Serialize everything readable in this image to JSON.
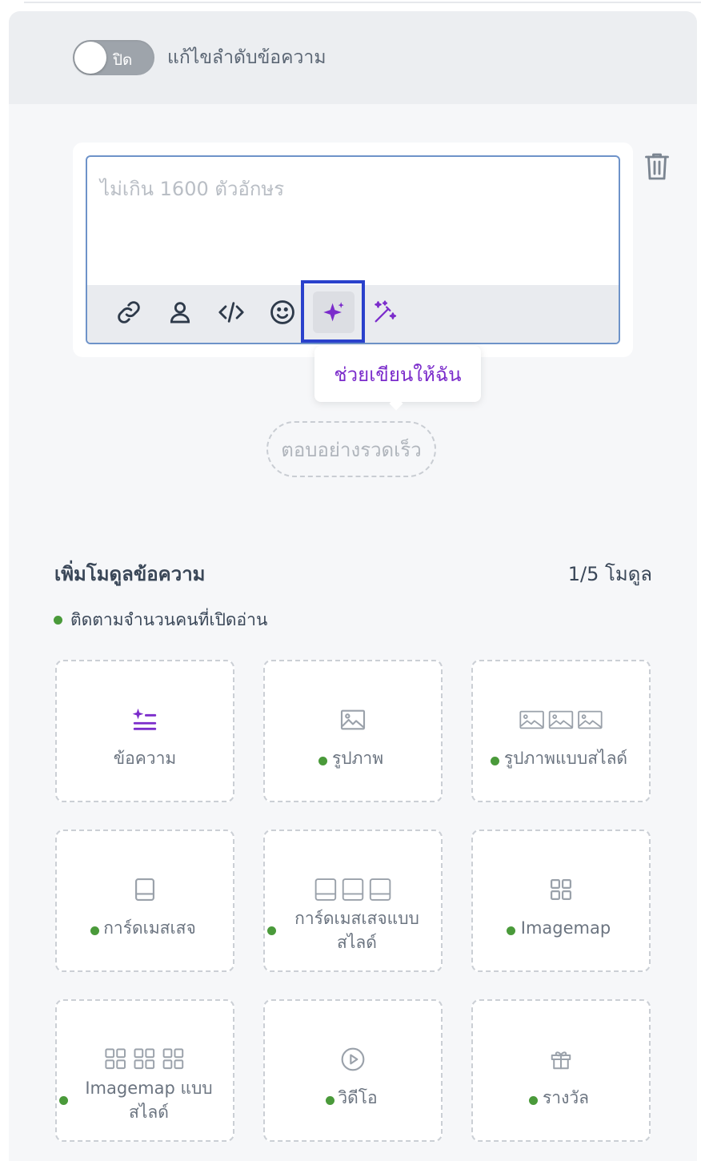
{
  "header": {
    "toggle_state": "ปิด",
    "toggle_label": "แก้ไขลำดับข้อความ"
  },
  "editor": {
    "placeholder": "ไม่เกิน 1600 ตัวอักษร",
    "tooltip": "ช่วยเขียนให้ฉัน",
    "toolbar_icons": [
      "link-icon",
      "person-icon",
      "code-icon",
      "smile-icon",
      "sparkle-icon",
      "magic-wand-icon"
    ]
  },
  "quick_reply": {
    "label": "ตอบอย่างรวดเร็ว"
  },
  "modules": {
    "title": "เพิ่มโมดูลข้อความ",
    "count": "1/5 โมดูล",
    "legend": "ติดตามจำนวนคนที่เปิดอ่าน",
    "items": [
      {
        "label": "ข้อความ",
        "icon": "text-ai-icon",
        "tracked": false
      },
      {
        "label": "รูปภาพ",
        "icon": "image-icon",
        "tracked": true
      },
      {
        "label": "รูปภาพแบบสไลด์",
        "icon": "image-carousel-icon",
        "tracked": true
      },
      {
        "label": "การ์ดเมสเสจ",
        "icon": "card-icon",
        "tracked": true
      },
      {
        "label_line1": "การ์ดเมสเสจแบบ",
        "label_line2": "สไลด์",
        "icon": "card-carousel-icon",
        "tracked": true
      },
      {
        "label": "Imagemap",
        "icon": "imagemap-icon",
        "tracked": true
      },
      {
        "label_line1": "Imagemap แบบ",
        "label_line2": "สไลด์",
        "icon": "imagemap-carousel-icon",
        "tracked": true
      },
      {
        "label": "วิดีโอ",
        "icon": "video-icon",
        "tracked": true
      },
      {
        "label": "รางวัล",
        "icon": "gift-icon",
        "tracked": true
      }
    ]
  },
  "colors": {
    "accent_purple": "#7b2ccb",
    "highlight_blue": "#2a41cc",
    "tracked_dot_green": "#4a9a3a"
  }
}
